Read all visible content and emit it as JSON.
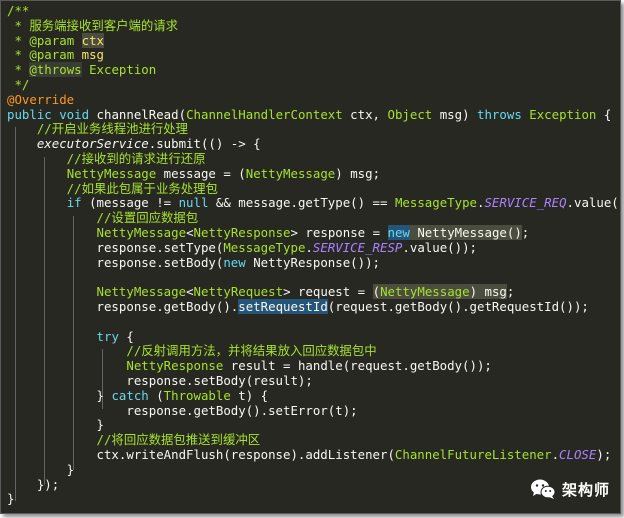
{
  "watermark": {
    "label": "架构师",
    "icon": "wechat-icon"
  },
  "colors": {
    "background": "#272822",
    "comment": "#a6e22e",
    "keyword": "#66d9ef",
    "type": "#a6e22e",
    "annotation": "#fd971f",
    "constant": "#ae81ff"
  },
  "code_lines": [
    [
      {
        "t": "/**",
        "c": "comment"
      }
    ],
    [
      {
        "t": " * 服务端接收到客户端的请求",
        "c": "comment"
      }
    ],
    [
      {
        "t": " * ",
        "c": "comment"
      },
      {
        "t": "@param",
        "c": "jdtag"
      },
      {
        "t": " ",
        "c": "comment"
      },
      {
        "t": "ctx",
        "c": "jdparam",
        "h": "match"
      }
    ],
    [
      {
        "t": " * ",
        "c": "comment"
      },
      {
        "t": "@param",
        "c": "jdtag"
      },
      {
        "t": " ",
        "c": "comment"
      },
      {
        "t": "msg",
        "c": "jdparam"
      }
    ],
    [
      {
        "t": " * ",
        "c": "comment"
      },
      {
        "t": "@throws",
        "c": "jdtag",
        "h": "brace"
      },
      {
        "t": " ",
        "c": "comment"
      },
      {
        "t": "Exception",
        "c": "comment"
      }
    ],
    [
      {
        "t": " */",
        "c": "comment"
      }
    ],
    [
      {
        "t": "@Override",
        "c": "ann"
      }
    ],
    [
      {
        "t": "public void ",
        "c": "kw"
      },
      {
        "t": "channelRead(",
        "c": "op"
      },
      {
        "t": "ChannelHandlerContext",
        "c": "type"
      },
      {
        "t": " ctx, ",
        "c": "op"
      },
      {
        "t": "Object",
        "c": "type"
      },
      {
        "t": " msg) ",
        "c": "op"
      },
      {
        "t": "throws ",
        "c": "kw"
      },
      {
        "t": "Exception",
        "c": "type"
      },
      {
        "t": " {",
        "c": "op"
      }
    ],
    [
      {
        "t": "    //开启业务线程池进行处理",
        "c": "comment"
      }
    ],
    [
      {
        "t": "    ",
        "c": "op"
      },
      {
        "t": "executorService",
        "c": "ivar"
      },
      {
        "t": ".submit(() -> {",
        "c": "op"
      }
    ],
    [
      {
        "t": "        //接收到的请求进行还原",
        "c": "comment"
      }
    ],
    [
      {
        "t": "        ",
        "c": "op"
      },
      {
        "t": "NettyMessage",
        "c": "type"
      },
      {
        "t": " message = (",
        "c": "op"
      },
      {
        "t": "NettyMessage",
        "c": "type"
      },
      {
        "t": ") msg;",
        "c": "op"
      }
    ],
    [
      {
        "t": "        //如果此包属于业务处理包",
        "c": "comment"
      }
    ],
    [
      {
        "t": "        ",
        "c": "op"
      },
      {
        "t": "if",
        "c": "kw"
      },
      {
        "t": " (message != ",
        "c": "op"
      },
      {
        "t": "null",
        "c": "kw"
      },
      {
        "t": " && message.getType() == ",
        "c": "op"
      },
      {
        "t": "MessageType",
        "c": "type"
      },
      {
        "t": ".",
        "c": "op"
      },
      {
        "t": "SERVICE_REQ",
        "c": "const"
      },
      {
        "t": ".value()) {",
        "c": "op"
      }
    ],
    [
      {
        "t": "            //设置回应数据包",
        "c": "comment"
      }
    ],
    [
      {
        "t": "            ",
        "c": "op"
      },
      {
        "t": "NettyMessage",
        "c": "type"
      },
      {
        "t": "<",
        "c": "op"
      },
      {
        "t": "NettyResponse",
        "c": "type"
      },
      {
        "t": "> response = ",
        "c": "op"
      },
      {
        "t": "new",
        "c": "kw",
        "h": "select"
      },
      {
        "t": " NettyMessage()",
        "c": "op",
        "h": "match"
      },
      {
        "t": ";",
        "c": "op"
      }
    ],
    [
      {
        "t": "            response.setType(",
        "c": "op"
      },
      {
        "t": "MessageType",
        "c": "type"
      },
      {
        "t": ".",
        "c": "op"
      },
      {
        "t": "SERVICE_RESP",
        "c": "const"
      },
      {
        "t": ".value());",
        "c": "op"
      }
    ],
    [
      {
        "t": "            response.setBody(",
        "c": "op"
      },
      {
        "t": "new",
        "c": "kw"
      },
      {
        "t": " NettyResponse());",
        "c": "op"
      }
    ],
    [
      {
        "t": "",
        "c": "op"
      }
    ],
    [
      {
        "t": "            ",
        "c": "op"
      },
      {
        "t": "NettyMessage",
        "c": "type"
      },
      {
        "t": "<",
        "c": "op"
      },
      {
        "t": "NettyRequest",
        "c": "type"
      },
      {
        "t": "> request = ",
        "c": "op"
      },
      {
        "t": "(",
        "c": "op",
        "h": "match"
      },
      {
        "t": "NettyMessage",
        "c": "type",
        "h": "match"
      },
      {
        "t": ") msg",
        "c": "op",
        "h": "match"
      },
      {
        "t": ";",
        "c": "op"
      }
    ],
    [
      {
        "t": "            response.getBody().",
        "c": "op"
      },
      {
        "t": "setRequestId",
        "c": "op",
        "h": "select"
      },
      {
        "t": "(request.getBody().getRequestId());",
        "c": "op"
      }
    ],
    [
      {
        "t": "",
        "c": "op"
      }
    ],
    [
      {
        "t": "            ",
        "c": "op"
      },
      {
        "t": "try",
        "c": "kw"
      },
      {
        "t": " {",
        "c": "op"
      }
    ],
    [
      {
        "t": "                //反射调用方法，并将结果放入回应数据包中",
        "c": "comment"
      }
    ],
    [
      {
        "t": "                ",
        "c": "op"
      },
      {
        "t": "NettyResponse",
        "c": "type"
      },
      {
        "t": " result = handle(request.getBody());",
        "c": "op"
      }
    ],
    [
      {
        "t": "                response.setBody(result);",
        "c": "op"
      }
    ],
    [
      {
        "t": "            } ",
        "c": "op"
      },
      {
        "t": "catch",
        "c": "kw"
      },
      {
        "t": " (",
        "c": "op"
      },
      {
        "t": "Throwable",
        "c": "type"
      },
      {
        "t": " t) {",
        "c": "op"
      }
    ],
    [
      {
        "t": "                response.getBody().setError(t);",
        "c": "op"
      }
    ],
    [
      {
        "t": "            }",
        "c": "op"
      }
    ],
    [
      {
        "t": "            //将回应数据包推送到缓冲区",
        "c": "comment"
      }
    ],
    [
      {
        "t": "            ctx.writeAndFlush(response).addListener(",
        "c": "op"
      },
      {
        "t": "ChannelFutureListener",
        "c": "type"
      },
      {
        "t": ".",
        "c": "op"
      },
      {
        "t": "CLOSE",
        "c": "const"
      },
      {
        "t": ");",
        "c": "op"
      }
    ],
    [
      {
        "t": "        }",
        "c": "op"
      }
    ],
    [
      {
        "t": "    });",
        "c": "op"
      }
    ],
    [
      {
        "t": "}",
        "c": "op"
      }
    ]
  ]
}
